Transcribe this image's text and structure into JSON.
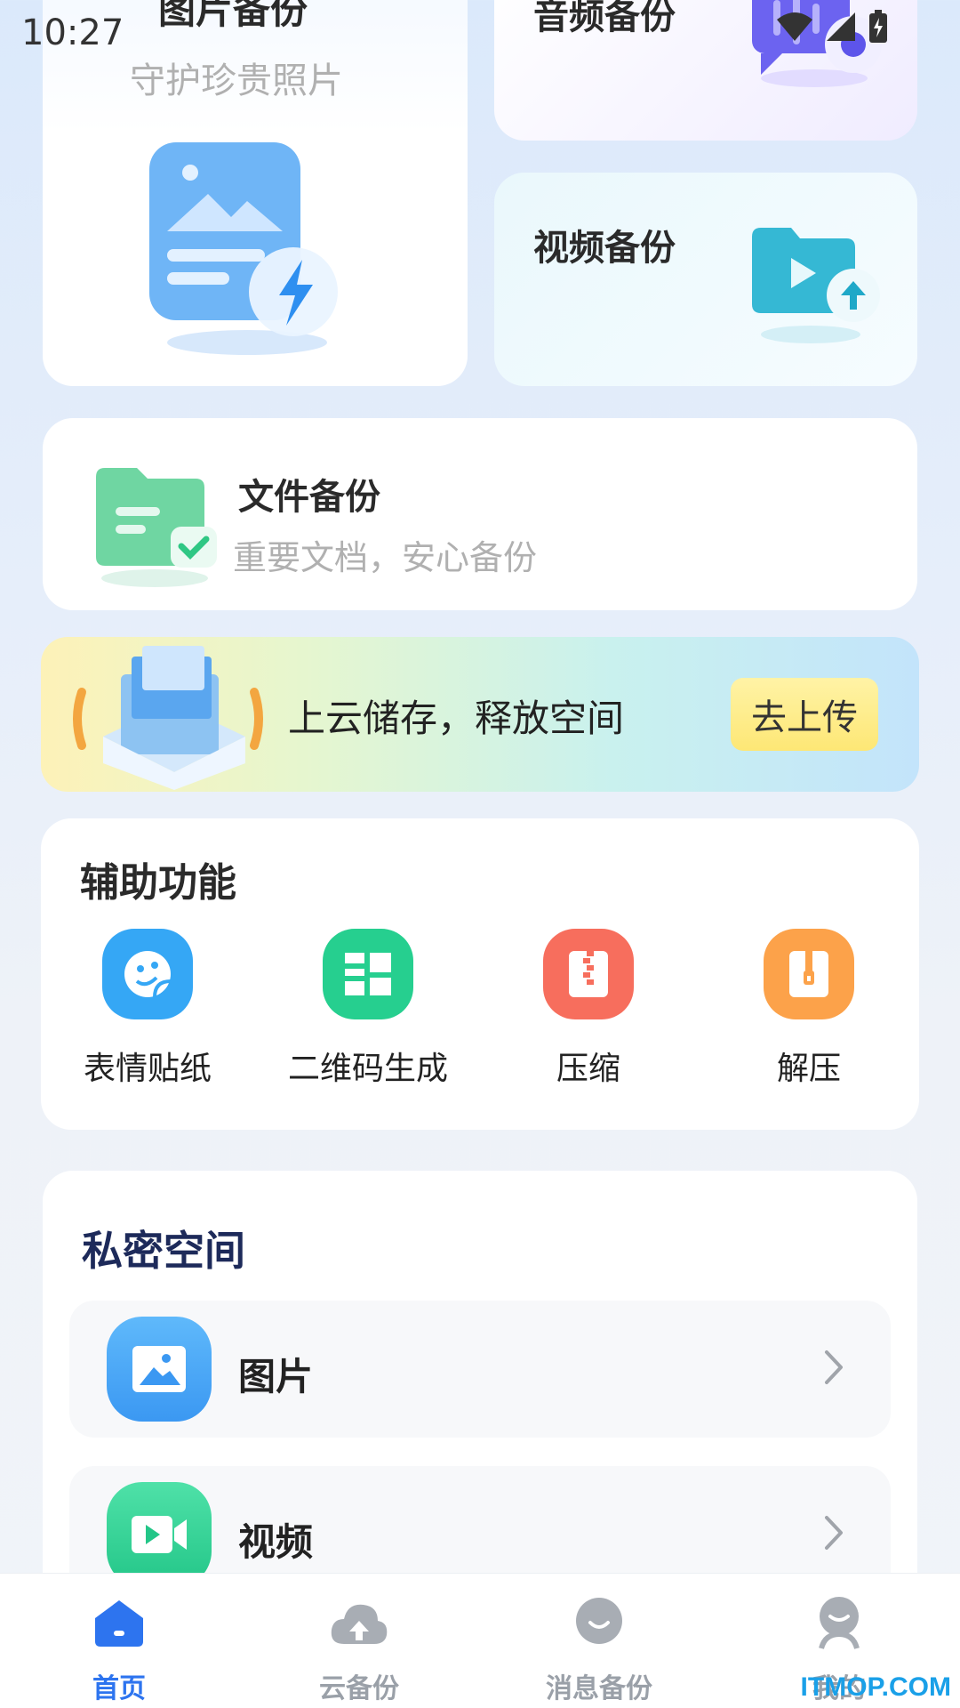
{
  "status_bar": {
    "time": "10:27"
  },
  "cards": {
    "photo": {
      "title": "图片备份",
      "subtitle": "守护珍贵照片"
    },
    "audio": {
      "title": "音频备份"
    },
    "video": {
      "title": "视频备份"
    },
    "file": {
      "title": "文件备份",
      "subtitle": "重要文档，安心备份"
    }
  },
  "banner": {
    "text": "上云储存，释放空间",
    "button": "去上传"
  },
  "tools": {
    "title": "辅助功能",
    "items": [
      {
        "label": "表情贴纸",
        "icon": "sticker-icon",
        "color": "#35a7f5"
      },
      {
        "label": "二维码生成",
        "icon": "qrcode-icon",
        "color": "#26cf8f"
      },
      {
        "label": "压缩",
        "icon": "compress-icon",
        "color": "#f76e5d"
      },
      {
        "label": "解压",
        "icon": "unzip-icon",
        "color": "#fca24a"
      }
    ]
  },
  "private_space": {
    "title": "私密空间",
    "items": [
      {
        "label": "图片",
        "icon": "image-icon"
      },
      {
        "label": "视频",
        "icon": "video-icon"
      }
    ]
  },
  "bottom_nav": {
    "items": [
      {
        "label": "首页",
        "icon": "home-icon",
        "active": true
      },
      {
        "label": "云备份",
        "icon": "cloud-upload-icon",
        "active": false
      },
      {
        "label": "消息备份",
        "icon": "message-icon",
        "active": false
      },
      {
        "label": "我的",
        "icon": "profile-icon",
        "active": false
      }
    ]
  },
  "watermark": "ITMOP.COM",
  "colors": {
    "accent": "#2d74ef",
    "private_title": "#1d2a5a"
  }
}
